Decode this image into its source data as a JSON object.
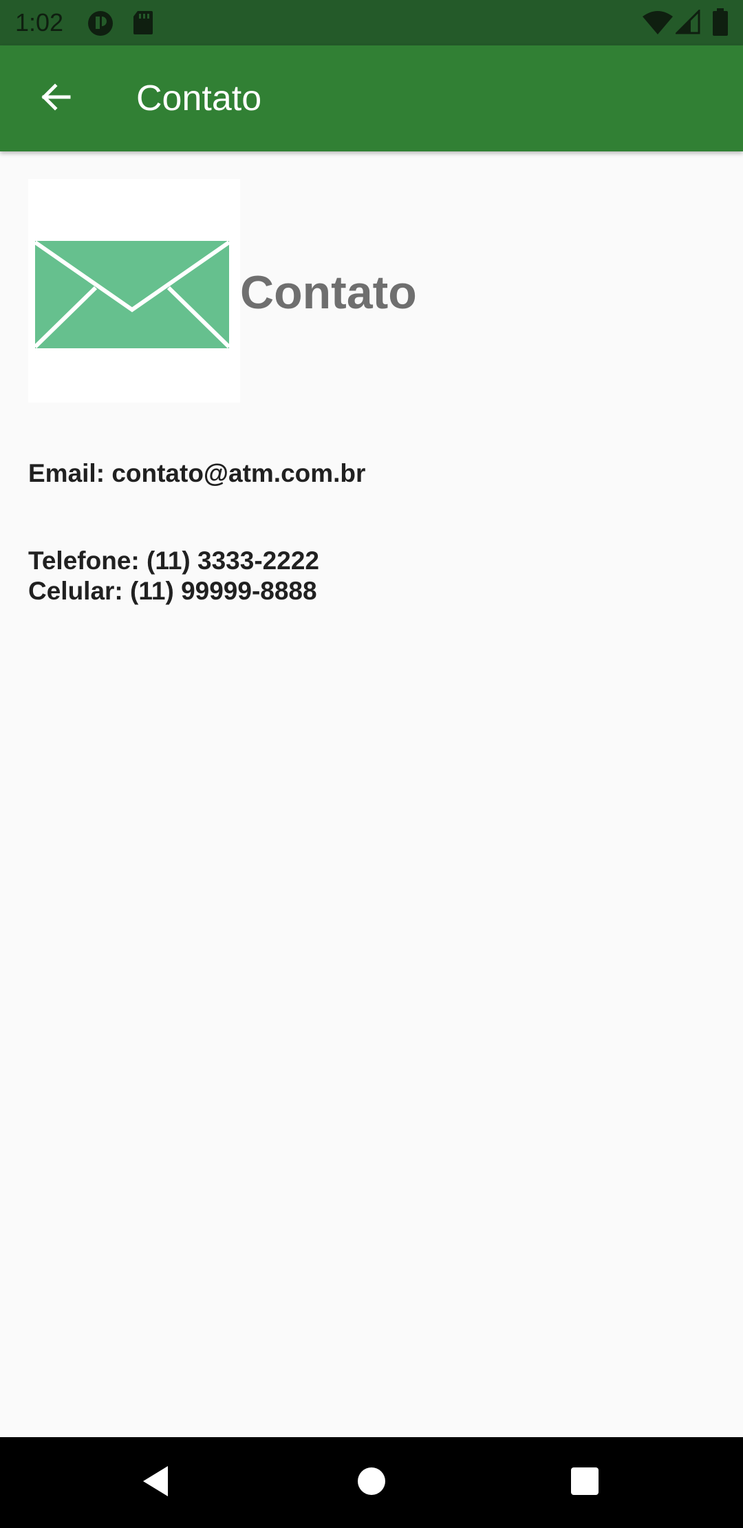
{
  "status_bar": {
    "time": "1:02",
    "icons": [
      "app-notification-icon",
      "sd-card-icon",
      "wifi-icon",
      "cell-signal-icon",
      "battery-icon"
    ]
  },
  "app_bar": {
    "title": "Contato",
    "back_icon": "arrow-back-icon",
    "background_color": "#318034"
  },
  "content": {
    "image_icon": "envelope-icon",
    "heading": "Contato",
    "email_line": "Email: contato@atm.com.br",
    "phone_line": "Telefone: (11) 3333-2222",
    "mobile_line": "Celular: (11) 99999-8888"
  },
  "nav_bar": {
    "buttons": [
      "back-triangle-icon",
      "home-circle-icon",
      "recents-square-icon"
    ]
  },
  "colors": {
    "status_bar": "#245a29",
    "app_bar": "#318034",
    "envelope": "#66c08e",
    "heading": "#6f6f6f",
    "body_text": "#212121"
  }
}
